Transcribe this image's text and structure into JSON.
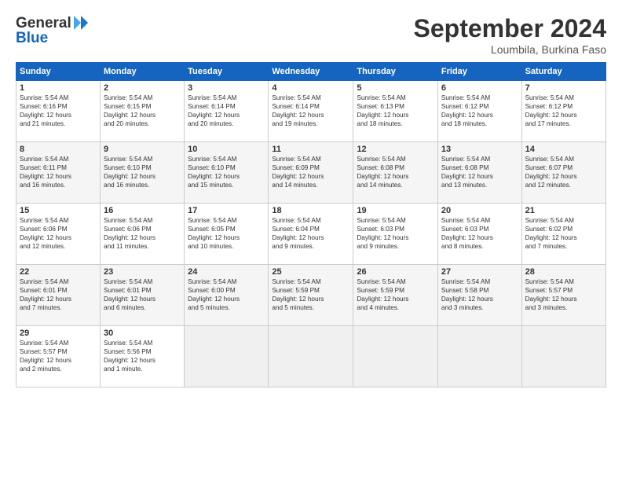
{
  "header": {
    "logo_general": "General",
    "logo_blue": "Blue",
    "month_title": "September 2024",
    "location": "Loumbila, Burkina Faso"
  },
  "weekdays": [
    "Sunday",
    "Monday",
    "Tuesday",
    "Wednesday",
    "Thursday",
    "Friday",
    "Saturday"
  ],
  "weeks": [
    [
      {
        "day": "1",
        "sunrise": "5:54 AM",
        "sunset": "6:16 PM",
        "daylight": "12 hours and 21 minutes."
      },
      {
        "day": "2",
        "sunrise": "5:54 AM",
        "sunset": "6:15 PM",
        "daylight": "12 hours and 20 minutes."
      },
      {
        "day": "3",
        "sunrise": "5:54 AM",
        "sunset": "6:14 PM",
        "daylight": "12 hours and 20 minutes."
      },
      {
        "day": "4",
        "sunrise": "5:54 AM",
        "sunset": "6:14 PM",
        "daylight": "12 hours and 19 minutes."
      },
      {
        "day": "5",
        "sunrise": "5:54 AM",
        "sunset": "6:13 PM",
        "daylight": "12 hours and 18 minutes."
      },
      {
        "day": "6",
        "sunrise": "5:54 AM",
        "sunset": "6:12 PM",
        "daylight": "12 hours and 18 minutes."
      },
      {
        "day": "7",
        "sunrise": "5:54 AM",
        "sunset": "6:12 PM",
        "daylight": "12 hours and 17 minutes."
      }
    ],
    [
      {
        "day": "8",
        "sunrise": "5:54 AM",
        "sunset": "6:11 PM",
        "daylight": "12 hours and 16 minutes."
      },
      {
        "day": "9",
        "sunrise": "5:54 AM",
        "sunset": "6:10 PM",
        "daylight": "12 hours and 16 minutes."
      },
      {
        "day": "10",
        "sunrise": "5:54 AM",
        "sunset": "6:10 PM",
        "daylight": "12 hours and 15 minutes."
      },
      {
        "day": "11",
        "sunrise": "5:54 AM",
        "sunset": "6:09 PM",
        "daylight": "12 hours and 14 minutes."
      },
      {
        "day": "12",
        "sunrise": "5:54 AM",
        "sunset": "6:08 PM",
        "daylight": "12 hours and 14 minutes."
      },
      {
        "day": "13",
        "sunrise": "5:54 AM",
        "sunset": "6:08 PM",
        "daylight": "12 hours and 13 minutes."
      },
      {
        "day": "14",
        "sunrise": "5:54 AM",
        "sunset": "6:07 PM",
        "daylight": "12 hours and 12 minutes."
      }
    ],
    [
      {
        "day": "15",
        "sunrise": "5:54 AM",
        "sunset": "6:06 PM",
        "daylight": "12 hours and 12 minutes."
      },
      {
        "day": "16",
        "sunrise": "5:54 AM",
        "sunset": "6:06 PM",
        "daylight": "12 hours and 11 minutes."
      },
      {
        "day": "17",
        "sunrise": "5:54 AM",
        "sunset": "6:05 PM",
        "daylight": "12 hours and 10 minutes."
      },
      {
        "day": "18",
        "sunrise": "5:54 AM",
        "sunset": "6:04 PM",
        "daylight": "12 hours and 9 minutes."
      },
      {
        "day": "19",
        "sunrise": "5:54 AM",
        "sunset": "6:03 PM",
        "daylight": "12 hours and 9 minutes."
      },
      {
        "day": "20",
        "sunrise": "5:54 AM",
        "sunset": "6:03 PM",
        "daylight": "12 hours and 8 minutes."
      },
      {
        "day": "21",
        "sunrise": "5:54 AM",
        "sunset": "6:02 PM",
        "daylight": "12 hours and 7 minutes."
      }
    ],
    [
      {
        "day": "22",
        "sunrise": "5:54 AM",
        "sunset": "6:01 PM",
        "daylight": "12 hours and 7 minutes."
      },
      {
        "day": "23",
        "sunrise": "5:54 AM",
        "sunset": "6:01 PM",
        "daylight": "12 hours and 6 minutes."
      },
      {
        "day": "24",
        "sunrise": "5:54 AM",
        "sunset": "6:00 PM",
        "daylight": "12 hours and 5 minutes."
      },
      {
        "day": "25",
        "sunrise": "5:54 AM",
        "sunset": "5:59 PM",
        "daylight": "12 hours and 5 minutes."
      },
      {
        "day": "26",
        "sunrise": "5:54 AM",
        "sunset": "5:59 PM",
        "daylight": "12 hours and 4 minutes."
      },
      {
        "day": "27",
        "sunrise": "5:54 AM",
        "sunset": "5:58 PM",
        "daylight": "12 hours and 3 minutes."
      },
      {
        "day": "28",
        "sunrise": "5:54 AM",
        "sunset": "5:57 PM",
        "daylight": "12 hours and 3 minutes."
      }
    ],
    [
      {
        "day": "29",
        "sunrise": "5:54 AM",
        "sunset": "5:57 PM",
        "daylight": "12 hours and 2 minutes."
      },
      {
        "day": "30",
        "sunrise": "5:54 AM",
        "sunset": "5:56 PM",
        "daylight": "12 hours and 1 minute."
      },
      null,
      null,
      null,
      null,
      null
    ]
  ]
}
